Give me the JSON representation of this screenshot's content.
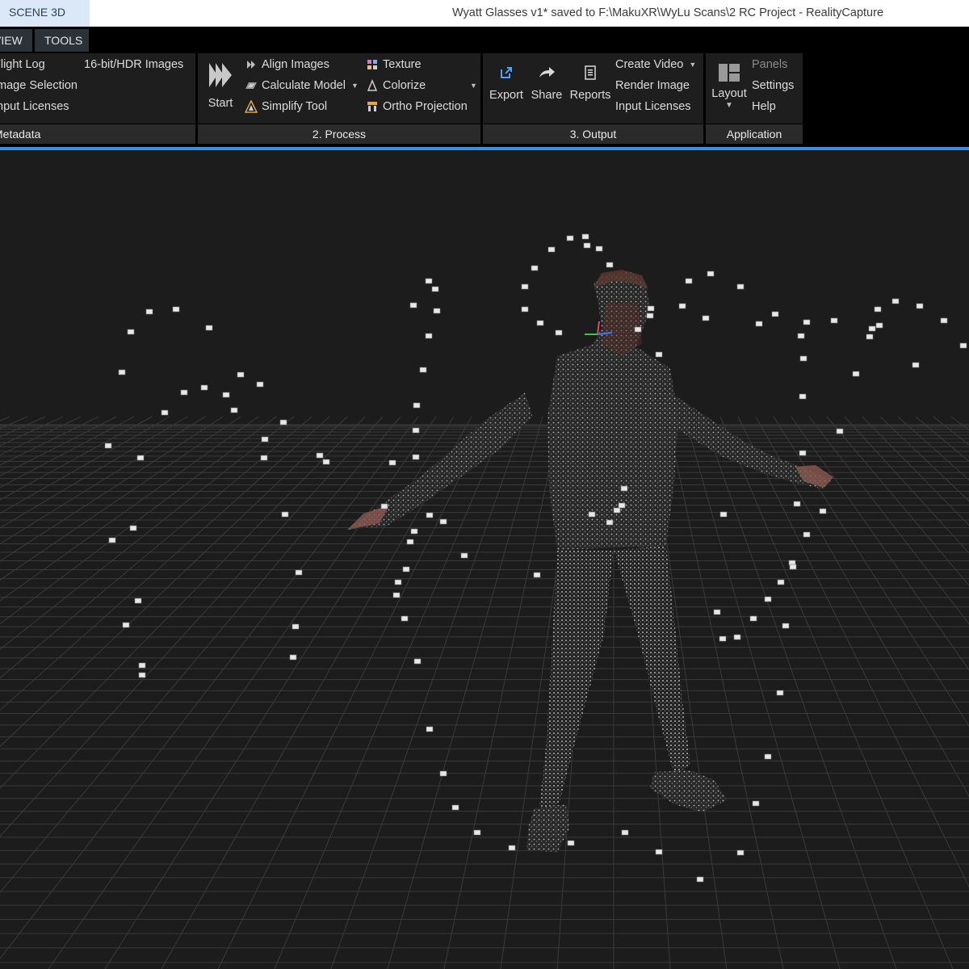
{
  "title_bar": {
    "scene_tab": "SCENE 3D",
    "window_title": "Wyatt Glasses v1* saved to F:\\MakuXR\\WyLu Scans\\2 RC Project - RealityCapture"
  },
  "menu_tabs": [
    "VIEW",
    "TOOLS"
  ],
  "groups": {
    "metadata": {
      "footer": "Metadata",
      "items": [
        "Flight Log",
        "Image Selection",
        "Input Licenses",
        "16-bit/HDR Images"
      ]
    },
    "process": {
      "footer": "2. Process",
      "start": "Start",
      "align": "Align Images",
      "calculate": "Calculate Model",
      "simplify": "Simplify Tool",
      "texture": "Texture",
      "colorize": "Colorize",
      "ortho": "Ortho Projection"
    },
    "output": {
      "footer": "3. Output",
      "export": "Export",
      "share": "Share",
      "reports": "Reports",
      "create_video": "Create Video",
      "render_image": "Render Image",
      "input_licenses": "Input Licenses"
    },
    "application": {
      "footer": "Application",
      "layout": "Layout",
      "panels": "Panels",
      "settings": "Settings",
      "help": "Help"
    }
  },
  "colors": {
    "accent": "#3b8fe0",
    "ribbon_bg": "#000000",
    "group_bg": "#1e1e1e",
    "viewport_bg": "#1c1c1c"
  }
}
